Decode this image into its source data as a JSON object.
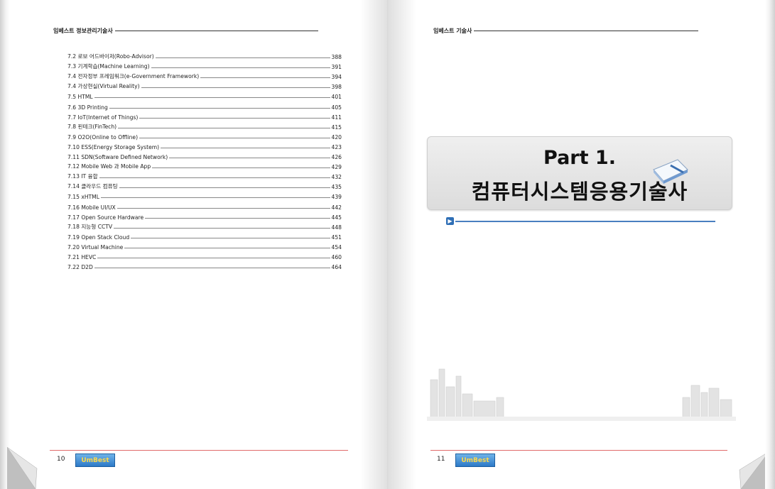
{
  "left_page": {
    "running_header": "임베스트 정보관리기술사",
    "toc": [
      {
        "title": "7.2 로보 어드바이저(Robo-Advisor)",
        "page": "388"
      },
      {
        "title": "7.3 기계학습(Machine Learning)",
        "page": "391"
      },
      {
        "title": "7.4 전자정부 프레임워크(e-Government Framework)",
        "page": "394"
      },
      {
        "title": "7.4 가상현실(Virtual Reality)",
        "page": "398"
      },
      {
        "title": "7.5 HTML",
        "page": "401"
      },
      {
        "title": "7.6 3D Printing",
        "page": "405"
      },
      {
        "title": "7.7 IoT(Internet of Things)",
        "page": "411"
      },
      {
        "title": "7.8 핀테크(FinTech)",
        "page": "415"
      },
      {
        "title": "7.9 O2O(Online to Offline)",
        "page": "420"
      },
      {
        "title": "7.10 ESS(Energy Storage System)",
        "page": "423"
      },
      {
        "title": "7.11 SDN(Software Defined Network)",
        "page": "426"
      },
      {
        "title": "7.12 Mobile Web 과 Mobile App",
        "page": "429"
      },
      {
        "title": "7.13 IT 융합",
        "page": "432"
      },
      {
        "title": "7.14 클라우드 컴퓨팅",
        "page": "435"
      },
      {
        "title": "7.15 xHTML",
        "page": "439"
      },
      {
        "title": "7.16 Mobile UI/UX",
        "page": "442"
      },
      {
        "title": "7.17 Open Source Hardware",
        "page": "445"
      },
      {
        "title": "7.18 지능형 CCTV",
        "page": "448"
      },
      {
        "title": "7.19 Open Stack Cloud",
        "page": "451"
      },
      {
        "title": "7.20 Virtual Machine",
        "page": "454"
      },
      {
        "title": "7.21 HEVC",
        "page": "460"
      },
      {
        "title": "7.22 D2D",
        "page": "464"
      }
    ],
    "page_number": "10",
    "logo_text": "UmBest"
  },
  "right_page": {
    "running_header": "임베스트 기술사",
    "part_title": "Part 1.",
    "part_subtitle": "컴퓨터시스템응용기술사",
    "page_number": "11",
    "logo_text": "UmBest"
  },
  "colors": {
    "footer_rule": "#e06a6a",
    "accent_blue": "#2f6fb6",
    "part_box_bg": "#e4e4e4"
  }
}
